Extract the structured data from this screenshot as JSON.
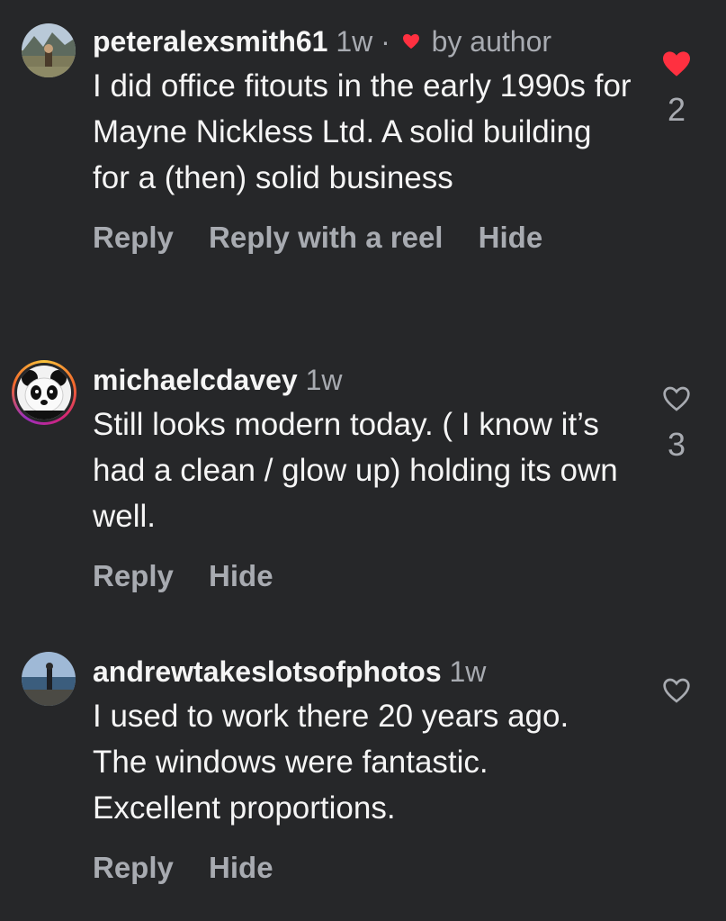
{
  "comments": [
    {
      "username": "peteralexsmith61",
      "time": "1w",
      "separator": "·",
      "author_like_label": "by author",
      "text": "I did office fitouts in the early 1990s for Mayne Nickless Ltd. A solid building for a (then) solid business",
      "actions": [
        "Reply",
        "Reply with a reel",
        "Hide"
      ],
      "liked": true,
      "like_count": "2"
    },
    {
      "username": "michaelcdavey",
      "time": "1w",
      "text": "Still looks modern today. ( I know it’s had a clean / glow up) holding its own well.",
      "actions": [
        "Reply",
        "Hide"
      ],
      "liked": false,
      "like_count": "3"
    },
    {
      "username": "andrewtakeslotsofphotos",
      "time": "1w",
      "text": "I used to work there 20 years ago. The windows were fantastic. Excellent proportions.",
      "actions": [
        "Reply",
        "Hide"
      ],
      "liked": false,
      "like_count": ""
    }
  ],
  "colors": {
    "background": "#262729",
    "text_primary": "#f5f5f5",
    "text_secondary": "#a8abb1",
    "like_red": "#ff3040"
  },
  "icons": {
    "liked": "heart-filled-icon",
    "unliked": "heart-outline-icon",
    "story_ring": "story-ring"
  }
}
